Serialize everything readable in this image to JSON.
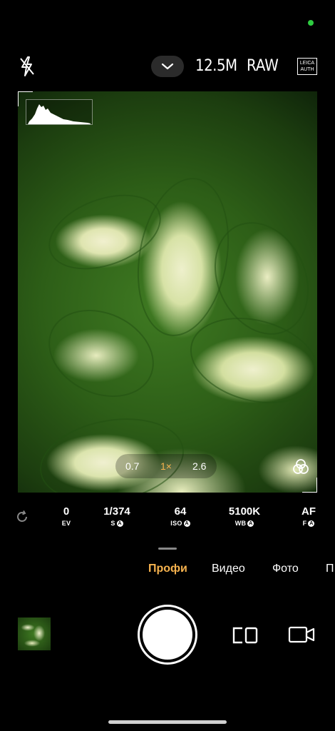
{
  "top_bar": {
    "resolution": "12.5M",
    "format": "RAW",
    "leica_top": "LEICA",
    "leica_bottom": "AUTH"
  },
  "zoom": {
    "options": [
      "0.7",
      "1×",
      "2.6"
    ],
    "active_index": 1
  },
  "settings": [
    {
      "value": "0",
      "label": "EV",
      "auto": false
    },
    {
      "value": "1/374",
      "label": "S",
      "auto": true
    },
    {
      "value": "64",
      "label": "ISO",
      "auto": true
    },
    {
      "value": "5100K",
      "label": "WB",
      "auto": true
    },
    {
      "value": "AF",
      "label": "F",
      "auto": true
    }
  ],
  "modes": [
    "Профи",
    "Видео",
    "Фото",
    "П"
  ],
  "active_mode": "Профи",
  "auto_badge": "A",
  "icons": {
    "flash": "flash-off-icon",
    "dropdown": "chevron-down-icon",
    "filters": "filters-icon",
    "reset": "reset-icon",
    "lens": "lens-switch-icon",
    "video": "video-camera-icon"
  },
  "colors": {
    "accent": "#f5b24e",
    "status": "#2ecc40",
    "background": "#000000"
  }
}
